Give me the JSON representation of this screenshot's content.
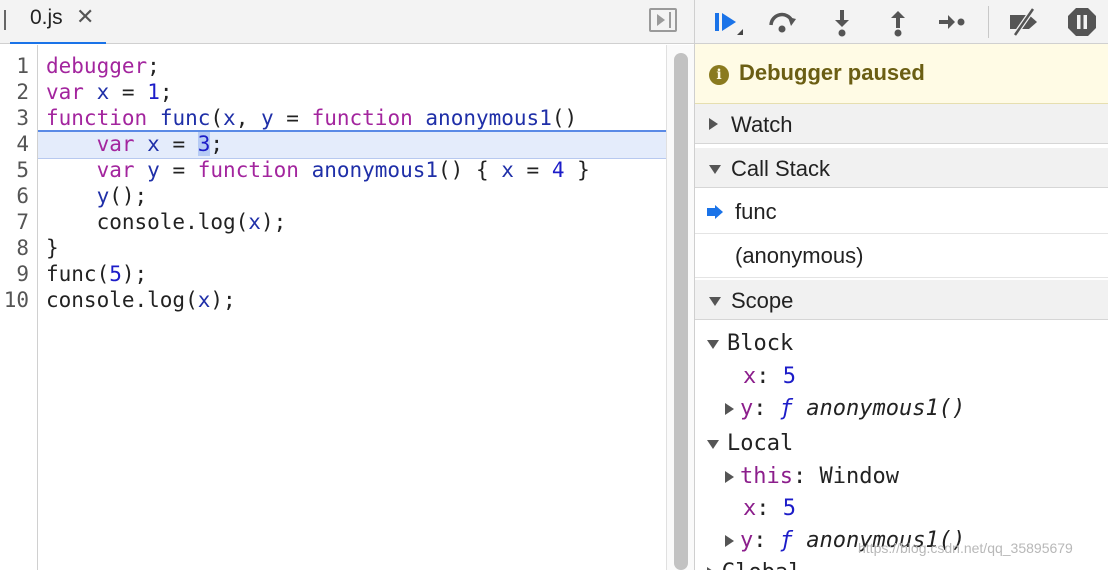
{
  "editor": {
    "tab": {
      "label": "0.js",
      "close": "✕"
    },
    "line_numbers": [
      "1",
      "2",
      "3",
      "4",
      "5",
      "6",
      "7",
      "8",
      "9",
      "10"
    ],
    "lines": [
      [
        {
          "t": "debugger",
          "c": "kw"
        },
        {
          "t": ";",
          "c": ""
        }
      ],
      [
        {
          "t": "var",
          "c": "kw"
        },
        {
          "t": " ",
          "c": ""
        },
        {
          "t": "x",
          "c": "vr"
        },
        {
          "t": " = ",
          "c": ""
        },
        {
          "t": "1",
          "c": "nm"
        },
        {
          "t": ";",
          "c": ""
        }
      ],
      [
        {
          "t": "function",
          "c": "kw"
        },
        {
          "t": " ",
          "c": ""
        },
        {
          "t": "func",
          "c": "vr"
        },
        {
          "t": "(",
          "c": ""
        },
        {
          "t": "x",
          "c": "vr"
        },
        {
          "t": ", ",
          "c": ""
        },
        {
          "t": "y",
          "c": "vr"
        },
        {
          "t": " = ",
          "c": ""
        },
        {
          "t": "function",
          "c": "kw"
        },
        {
          "t": " ",
          "c": ""
        },
        {
          "t": "anonymous1",
          "c": "vr"
        },
        {
          "t": "()",
          "c": ""
        }
      ],
      [
        {
          "t": "    ",
          "c": ""
        },
        {
          "t": "var",
          "c": "kw"
        },
        {
          "t": " ",
          "c": ""
        },
        {
          "t": "x",
          "c": "vr"
        },
        {
          "t": " = ",
          "c": ""
        },
        {
          "t": "3",
          "c": "nm hl"
        },
        {
          "t": ";",
          "c": ""
        }
      ],
      [
        {
          "t": "    ",
          "c": ""
        },
        {
          "t": "var",
          "c": "kw"
        },
        {
          "t": " ",
          "c": ""
        },
        {
          "t": "y",
          "c": "vr"
        },
        {
          "t": " = ",
          "c": ""
        },
        {
          "t": "function",
          "c": "kw"
        },
        {
          "t": " ",
          "c": ""
        },
        {
          "t": "anonymous1",
          "c": "vr"
        },
        {
          "t": "() { ",
          "c": ""
        },
        {
          "t": "x",
          "c": "vr"
        },
        {
          "t": " = ",
          "c": ""
        },
        {
          "t": "4",
          "c": "nm"
        },
        {
          "t": " }",
          "c": ""
        }
      ],
      [
        {
          "t": "    ",
          "c": ""
        },
        {
          "t": "y",
          "c": "vr"
        },
        {
          "t": "();",
          "c": ""
        }
      ],
      [
        {
          "t": "    console.log(",
          "c": ""
        },
        {
          "t": "x",
          "c": "vr"
        },
        {
          "t": ");",
          "c": ""
        }
      ],
      [
        {
          "t": "}",
          "c": ""
        }
      ],
      [
        {
          "t": "func(",
          "c": ""
        },
        {
          "t": "5",
          "c": "nm"
        },
        {
          "t": ");",
          "c": ""
        }
      ],
      [
        {
          "t": "console.log(",
          "c": ""
        },
        {
          "t": "x",
          "c": "vr"
        },
        {
          "t": ");",
          "c": ""
        }
      ]
    ]
  },
  "debugger": {
    "paused_label": "Debugger paused",
    "paused_icon": "i",
    "sections": {
      "watch": "Watch",
      "call_stack": "Call Stack",
      "scope": "Scope"
    },
    "call_stack": [
      "func",
      "(anonymous)"
    ],
    "scope": {
      "block": {
        "label": "Block",
        "x_name": "x",
        "x_value": "5",
        "y_name": "y",
        "y_value_f": "ƒ",
        "y_value_name": "anonymous1()"
      },
      "local": {
        "label": "Local",
        "this_name": "this",
        "this_value": "Window",
        "x_name": "x",
        "x_value": "5",
        "y_name": "y",
        "y_value_f": "ƒ",
        "y_value_name": "anonymous1()"
      },
      "global": {
        "label": "Global"
      }
    }
  },
  "watermark": "https://blog.csdn.net/qq_35895679",
  "colors": {
    "accent": "#1a73e8",
    "paused_bg": "#fffbe5",
    "keyword": "#a3259e",
    "variable": "#1f2fa8"
  },
  "icons": [
    "resume-icon",
    "step-over-icon",
    "step-into-icon",
    "step-out-icon",
    "step-icon",
    "deactivate-breakpoints-icon",
    "pause-on-exceptions-icon",
    "toggle-sidebar-icon",
    "info-icon",
    "execution-arrow-icon"
  ]
}
